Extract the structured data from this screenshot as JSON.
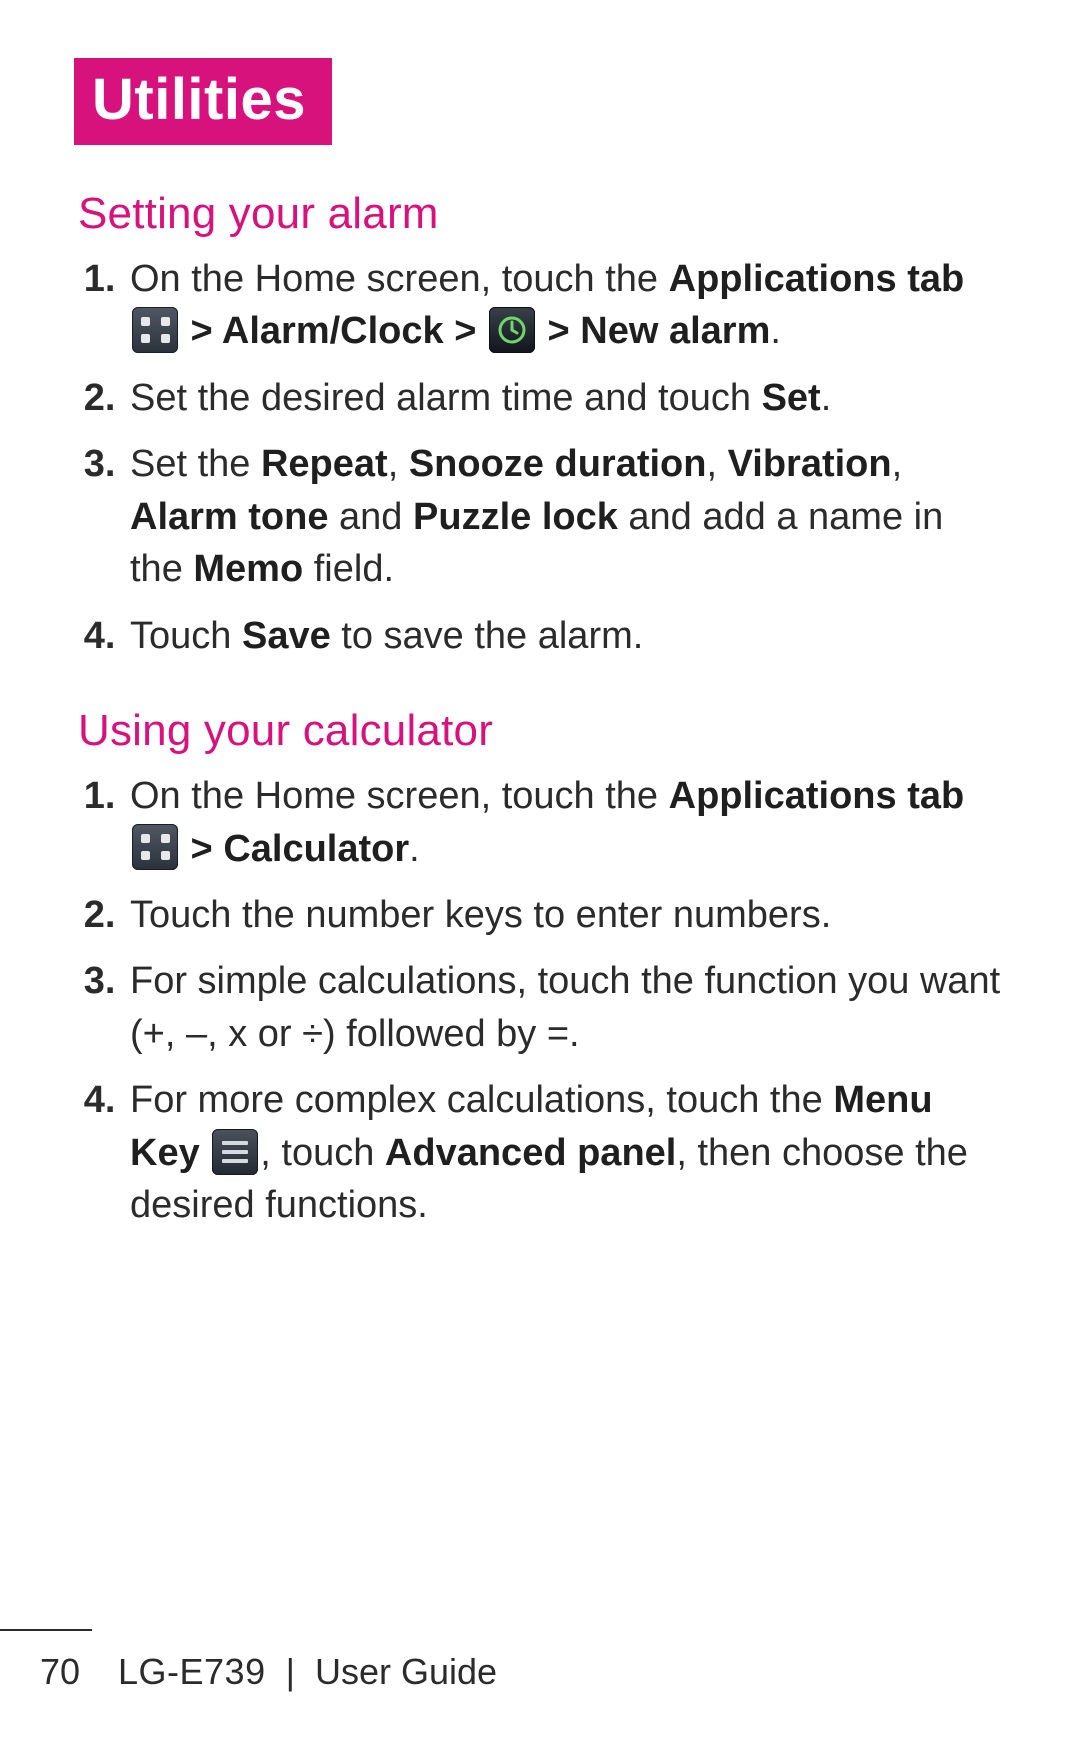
{
  "chapter_title": "Utilities",
  "sections": {
    "alarm": {
      "heading": "Setting your alarm",
      "step1_a": "On the Home screen, touch the ",
      "step1_b": "Applications tab",
      "step1_c": " > ",
      "step1_d": "Alarm/Clock",
      "step1_e": " > ",
      "step1_f": " > ",
      "step1_g": "New alarm",
      "step1_h": ".",
      "step2_a": "Set the desired alarm time and touch ",
      "step2_b": "Set",
      "step2_c": ".",
      "step3_a": "Set the ",
      "step3_b": "Repeat",
      "step3_c": ", ",
      "step3_d": "Snooze duration",
      "step3_e": ", ",
      "step3_f": "Vibration",
      "step3_g": ", ",
      "step3_h": "Alarm tone",
      "step3_i": " and ",
      "step3_j": "Puzzle lock",
      "step3_k": " and add a name in the ",
      "step3_l": "Memo",
      "step3_m": " field.",
      "step4_a": "Touch ",
      "step4_b": "Save",
      "step4_c": " to save the alarm."
    },
    "calc": {
      "heading": "Using your calculator",
      "step1_a": "On the Home screen, touch the ",
      "step1_b": "Applications tab",
      "step1_c": " > ",
      "step1_d": "Calculator",
      "step1_e": ".",
      "step2": "Touch the number keys to enter numbers.",
      "step3": "For simple calculations, touch the function you want (+, –, x or ÷) followed by =.",
      "step4_a": "For more complex calculations, touch the ",
      "step4_b": "Menu Key",
      "step4_c": ", touch ",
      "step4_d": "Advanced panel",
      "step4_e": ", then choose the desired functions."
    }
  },
  "footer": {
    "page_number": "70",
    "model": "LG-E739",
    "separator": "|",
    "doc_title": "User Guide"
  },
  "icons": {
    "apps": "apps-tab-icon",
    "alarm": "alarm-clock-icon",
    "menu": "menu-key-icon"
  }
}
